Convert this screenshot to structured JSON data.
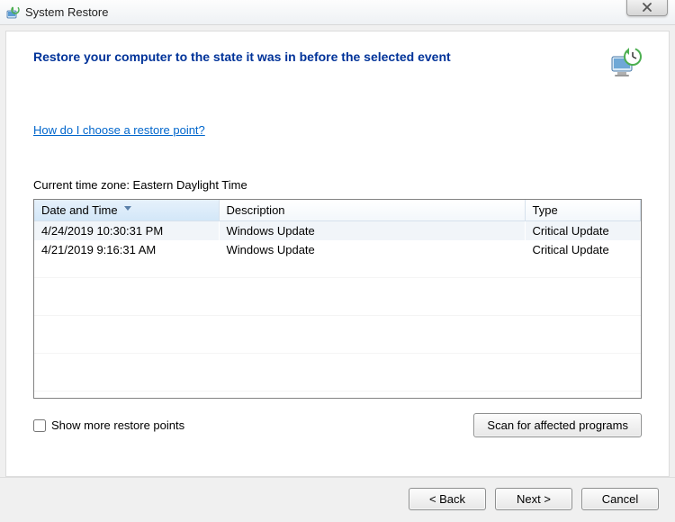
{
  "window": {
    "title": "System Restore"
  },
  "heading": "Restore your computer to the state it was in before the selected event",
  "help_link": "How do I choose a restore point?",
  "timezone_label": "Current time zone: Eastern Daylight Time",
  "table": {
    "columns": {
      "date": "Date and Time",
      "description": "Description",
      "type": "Type"
    },
    "rows": [
      {
        "date": "4/24/2019 10:30:31 PM",
        "description": "Windows Update",
        "type": "Critical Update"
      },
      {
        "date": "4/21/2019 9:16:31 AM",
        "description": "Windows Update",
        "type": "Critical Update"
      }
    ]
  },
  "checkbox_label": "Show more restore points",
  "buttons": {
    "scan": "Scan for affected programs",
    "back": "< Back",
    "next": "Next >",
    "cancel": "Cancel"
  }
}
